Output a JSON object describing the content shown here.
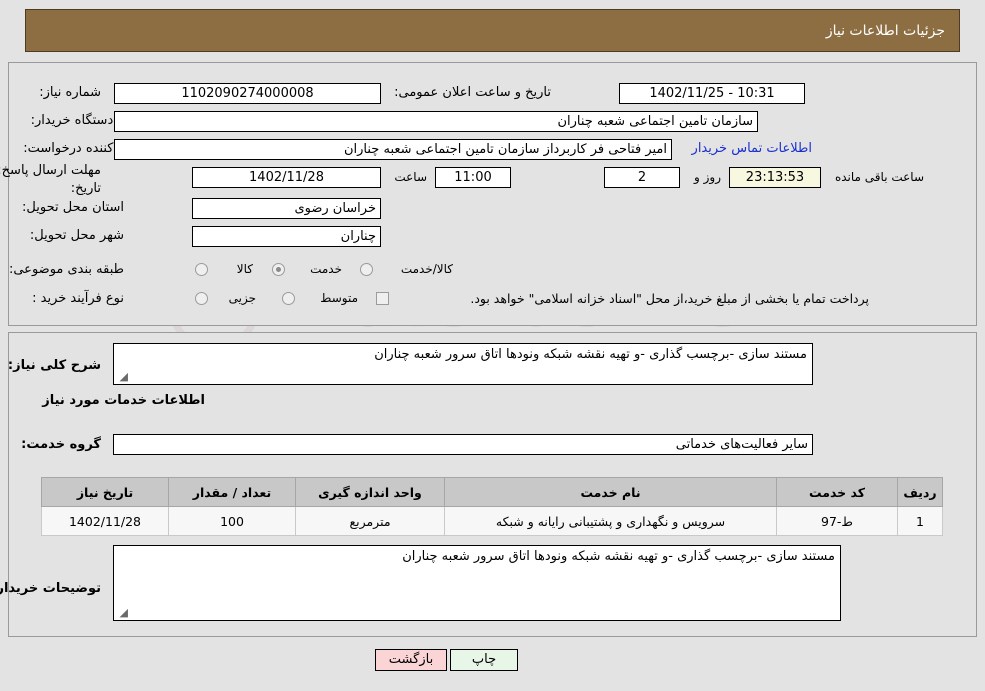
{
  "header": {
    "title": "جزئیات اطلاعات نیاز"
  },
  "form": {
    "need_number_label": "شماره نیاز:",
    "need_number_value": "1102090274000008",
    "announce_label": "تاریخ و ساعت اعلان عمومی:",
    "announce_value": "10:31 - 1402/11/25",
    "buyer_org_label": "نام دستگاه خریدار:",
    "buyer_org_value": "سازمان تامین اجتماعی شعبه چناران",
    "creator_label": "ایجاد کننده درخواست:",
    "creator_value": "امیر فتاحی فر کاربرداز سازمان تامین اجتماعی شعبه چناران",
    "contact_link": "اطلاعات تماس خریدار",
    "deadline_label_1": "مهلت ارسال پاسخ: تا",
    "deadline_label_2": "تاریخ:",
    "deadline_date": "1402/11/28",
    "hour_word": "ساعت",
    "deadline_time": "11:00",
    "days_value": "2",
    "days_word": "روز و",
    "countdown": "23:13:53",
    "remaining_word": "ساعت باقی مانده",
    "province_label": "استان محل تحویل:",
    "province_value": "خراسان رضوی",
    "city_label": "شهر محل تحویل:",
    "city_value": "چناران",
    "category_label": "طبقه بندی موضوعی:",
    "category_options": [
      "کالا",
      "خدمت",
      "کالا/خدمت"
    ],
    "category_selected": "خدمت",
    "process_label": "نوع فرآیند خرید :",
    "process_options": [
      "جزیی",
      "متوسط"
    ],
    "process_selected": "",
    "treasury_note": "پرداخت تمام یا بخشی از مبلغ خرید،از محل \"اسناد خزانه اسلامی\" خواهد بود."
  },
  "description": {
    "label": "شرح کلی نیاز:",
    "value": "مستند سازی -برچسب گذاری -و تهیه نقشه شبکه ونودها اتاق سرور  شعبه چناران"
  },
  "services_section": {
    "title": "اطلاعات خدمات مورد نیاز",
    "group_label": "گروه خدمت:",
    "group_value": "سایر فعالیت‌های خدماتی"
  },
  "table": {
    "columns": [
      "ردیف",
      "کد خدمت",
      "نام خدمت",
      "واحد اندازه گیری",
      "تعداد / مقدار",
      "تاریخ نیاز"
    ],
    "rows": [
      {
        "row_no": "1",
        "service_code": "ط-97",
        "service_name": "سرویس و نگهداری و پشتیبانی رایانه و شبکه",
        "unit": "مترمربع",
        "quantity": "100",
        "need_date": "1402/11/28"
      }
    ]
  },
  "buyer_notes": {
    "label": "توضیحات خریدار:",
    "value": "مستند سازی -برچسب گذاری -و تهیه نقشه شبکه ونودها اتاق سرور  شعبه چناران"
  },
  "buttons": {
    "print": "چاپ",
    "back": "بازگشت"
  },
  "watermark": {
    "text": "AriaTender.net",
    "v": "V"
  }
}
